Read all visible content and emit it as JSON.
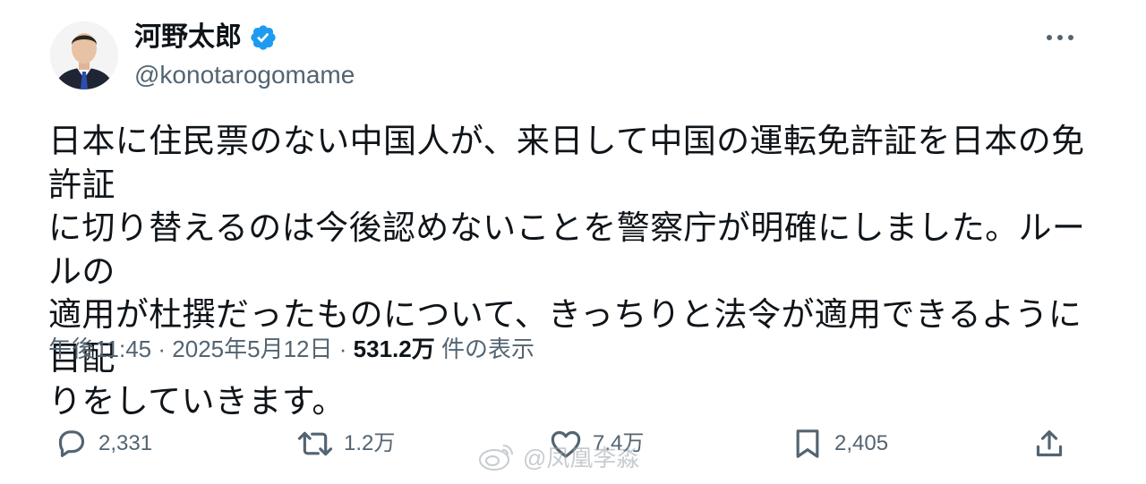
{
  "author": {
    "display_name": "河野太郎",
    "handle": "@konotarogomame",
    "verified": true,
    "verified_color": "#1d9bf0"
  },
  "tweet": {
    "text": "日本に住民票のない中国人が、来日して中国の運転免許証を日本の免許証\nに切り替えるのは今後認めないことを警察庁が明確にしました。ルールの\n適用が杜撰だったものについて、きっちりと法令が適用できるように目配\nりをしていきます。",
    "time": "午後11:45",
    "date": "2025年5月12日",
    "views_count": "531.2万",
    "views_label": "件の表示",
    "separator": "·"
  },
  "actions": {
    "replies": {
      "icon": "reply-icon",
      "count": "2,331"
    },
    "reposts": {
      "icon": "repost-icon",
      "count": "1.2万"
    },
    "likes": {
      "icon": "heart-icon",
      "count": "7.4万"
    },
    "bookmarks": {
      "icon": "bookmark-icon",
      "count": "2,405"
    },
    "share": {
      "icon": "share-icon"
    }
  },
  "watermark": {
    "text": "@凤凰李淼",
    "icon": "weibo-icon"
  },
  "colors": {
    "text_primary": "#0f1419",
    "text_secondary": "#536471",
    "accent": "#1d9bf0"
  }
}
